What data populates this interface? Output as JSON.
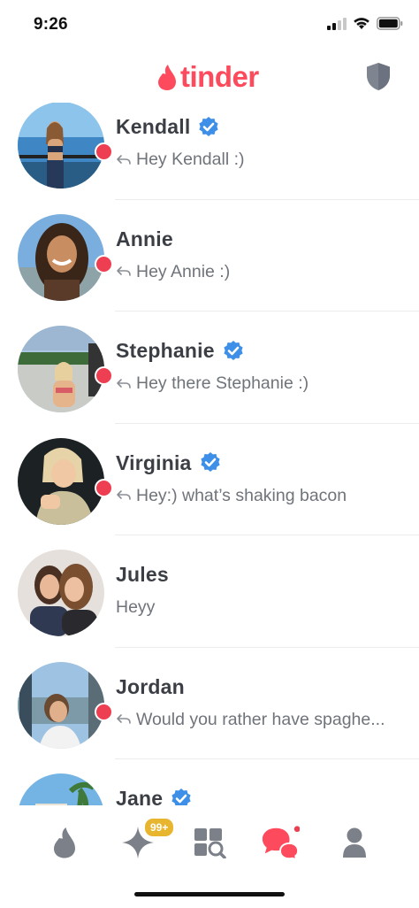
{
  "status_bar": {
    "time": "9:26"
  },
  "header": {
    "logo_text": "tinder"
  },
  "matches": [
    {
      "name": "Kendall",
      "verified": true,
      "unread": true,
      "replied": true,
      "message": "Hey Kendall :)"
    },
    {
      "name": "Annie",
      "verified": false,
      "unread": true,
      "replied": true,
      "message": "Hey Annie :)"
    },
    {
      "name": "Stephanie",
      "verified": true,
      "unread": true,
      "replied": true,
      "message": "Hey there Stephanie :)"
    },
    {
      "name": "Virginia",
      "verified": true,
      "unread": true,
      "replied": true,
      "message": "Hey:) what’s shaking bacon"
    },
    {
      "name": "Jules",
      "verified": false,
      "unread": false,
      "replied": false,
      "message": "Heyy"
    },
    {
      "name": "Jordan",
      "verified": false,
      "unread": true,
      "replied": true,
      "message": "Would you rather have spaghe..."
    },
    {
      "name": "Jane",
      "verified": true,
      "unread": true,
      "replied": false,
      "message": ""
    }
  ],
  "tabbar": {
    "tabs": [
      {
        "id": "swipe",
        "icon": "flame-icon",
        "active": false
      },
      {
        "id": "gold",
        "icon": "sparkle-icon",
        "active": false,
        "badge": "99+"
      },
      {
        "id": "explore",
        "icon": "explore-icon",
        "active": false
      },
      {
        "id": "messages",
        "icon": "chat-bubbles-icon",
        "active": true
      },
      {
        "id": "profile",
        "icon": "person-icon",
        "active": false
      }
    ]
  },
  "colors": {
    "brand": "#fd4a5c",
    "unread": "#ee3f52",
    "verified": "#3e8fe8",
    "gold": "#e8b52f",
    "inactive_icon": "#7b8089"
  }
}
